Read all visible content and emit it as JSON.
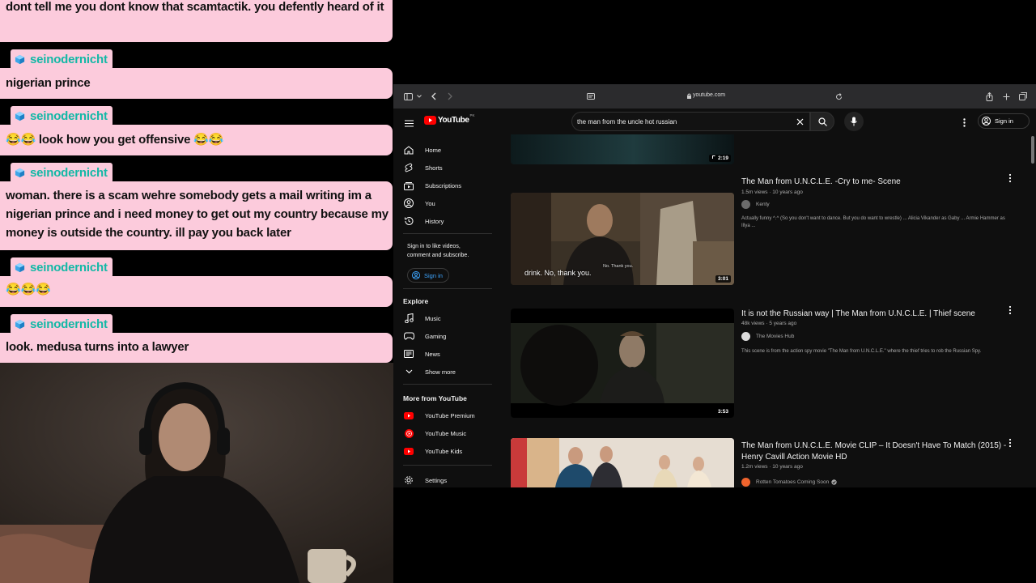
{
  "chat": {
    "top_message": "dont tell me you dont know that scamtactik. you defently heard of it",
    "messages": [
      {
        "user": "seinodernicht",
        "text": "nigerian prince"
      },
      {
        "user": "seinodernicht",
        "text": "😂😂 look how you get offensive 😂😂"
      },
      {
        "user": "seinodernicht",
        "text": "woman. there is a scam wehre somebody gets a mail writing im a nigerian prince and i need money to get out my country because my money is outside the country. ill pay you back later"
      },
      {
        "user": "seinodernicht",
        "text": "😂😂😂"
      },
      {
        "user": "seinodernicht",
        "text": "look. medusa turns into a lawyer"
      }
    ]
  },
  "browser": {
    "url": "youtube.com",
    "search_query": "the man from the uncle hot russian",
    "logo_text": "YouTube",
    "logo_sup": "PK",
    "sign_in": "Sign in"
  },
  "sidebar": {
    "main": [
      {
        "label": "Home",
        "icon": "home-icon"
      },
      {
        "label": "Shorts",
        "icon": "shorts-icon"
      },
      {
        "label": "Subscriptions",
        "icon": "subscriptions-icon"
      },
      {
        "label": "You",
        "icon": "you-icon"
      },
      {
        "label": "History",
        "icon": "history-icon"
      }
    ],
    "signin_prompt": "Sign in to like videos, comment and subscribe.",
    "signin_button": "Sign in",
    "explore_title": "Explore",
    "explore": [
      {
        "label": "Music",
        "icon": "music-icon"
      },
      {
        "label": "Gaming",
        "icon": "gaming-icon"
      },
      {
        "label": "News",
        "icon": "news-icon"
      },
      {
        "label": "Show more",
        "icon": "chevron-down-icon"
      }
    ],
    "more_title": "More from YouTube",
    "more": [
      {
        "label": "YouTube Premium"
      },
      {
        "label": "YouTube Music"
      },
      {
        "label": "YouTube Kids"
      }
    ],
    "settings": "Settings"
  },
  "results": {
    "partial_duration": "2:19",
    "videos": [
      {
        "title": "The Man from U.N.C.L.E. -Cry to me- Scene",
        "meta": "1.5m views · 10 years ago",
        "channel": "Kenty",
        "description": "Actually funny ^.^ (So you don't want to dance. But you do want to wrestle) ... Alicia Vikander as Gaby ... Armie Hammer as Illya ...",
        "duration": "3:01",
        "subtitle": "drink. No, thank you.",
        "subtitle2": "No. Thank you.",
        "avatar_color": "#6b6b6b"
      },
      {
        "title": "It is not the Russian way | The Man from U.N.C.L.E. | Thief scene",
        "meta": "48k views · 5 years ago",
        "channel": "The Movies Hub",
        "description": "This scene is from the action spy movie \"The Man from U.N.C.L.E.\" where the thief tries to rob the Russian Spy.",
        "duration": "3:53",
        "avatar_color": "#dddddd"
      },
      {
        "title": "The Man from U.N.C.L.E. Movie CLIP – It Doesn't Have To Match (2015) - Henry Cavill Action Movie HD",
        "meta": "1.2m views · 10 years ago",
        "channel": "Rotten Tomatoes Coming Soon",
        "description": "",
        "duration": "",
        "avatar_color": "#f0642d"
      }
    ]
  }
}
